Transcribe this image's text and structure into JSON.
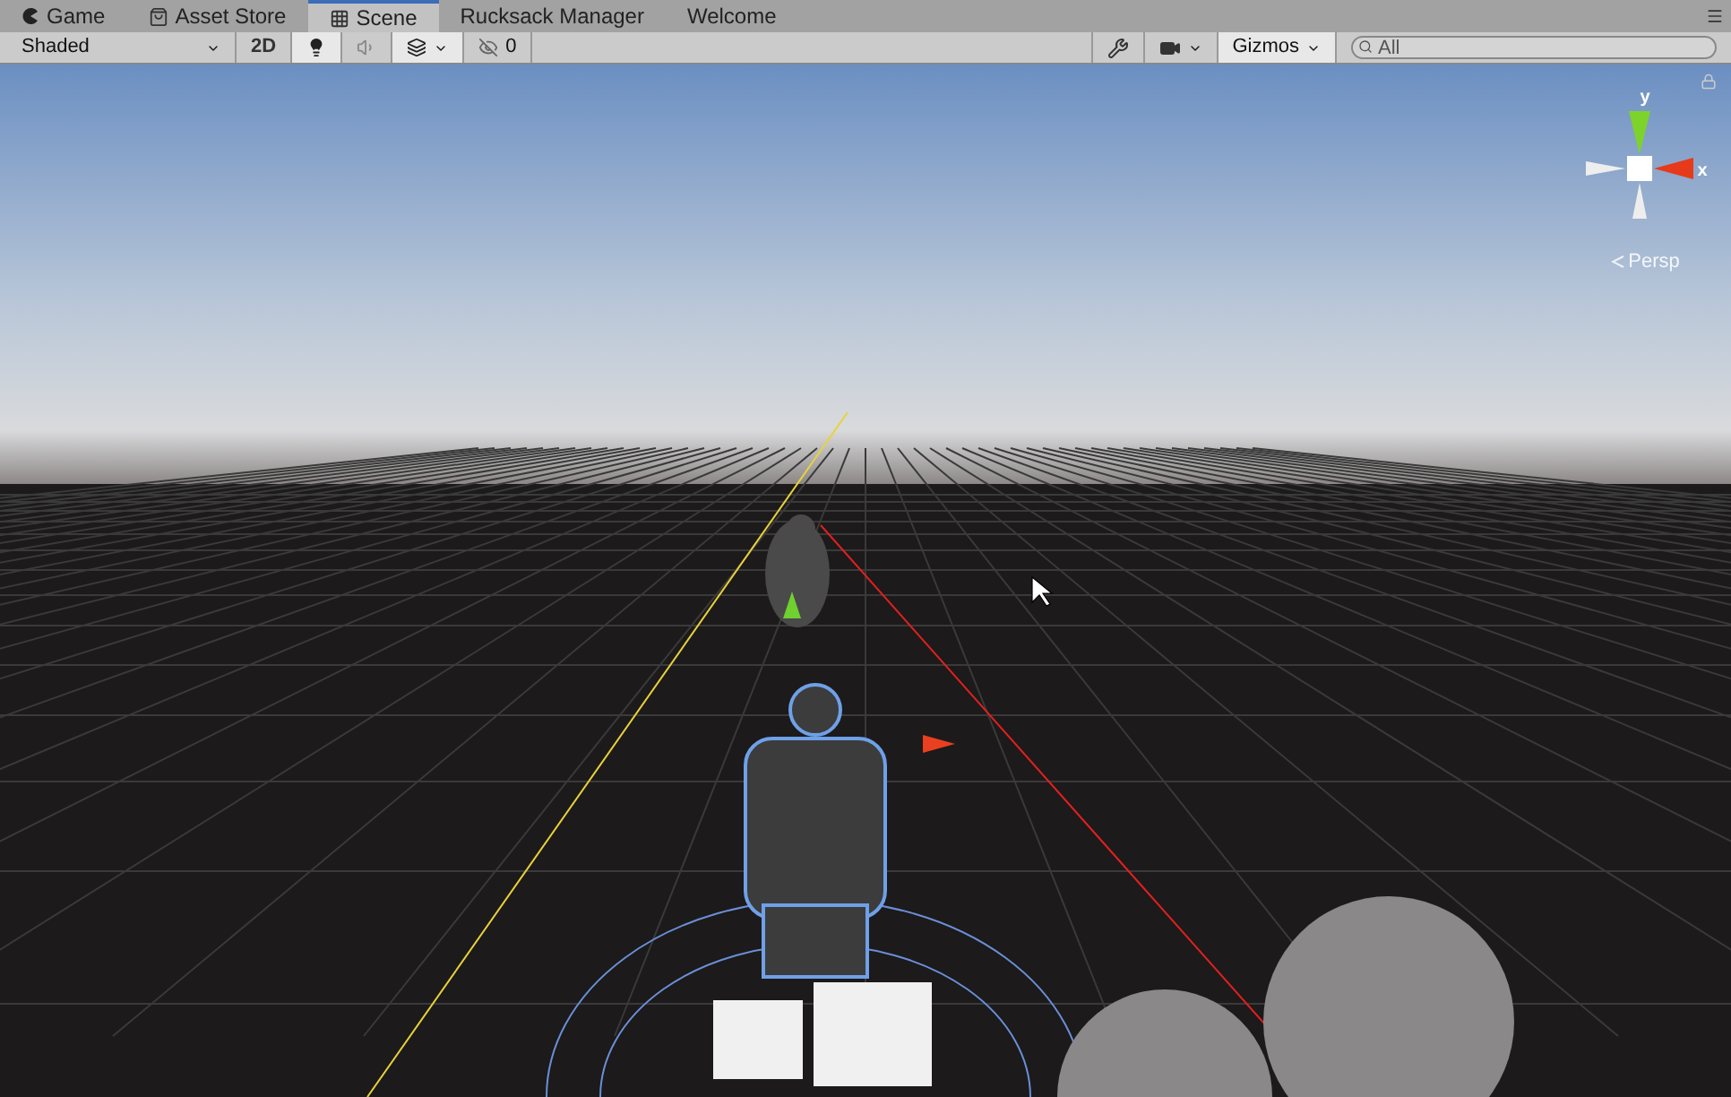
{
  "tabs": [
    {
      "label": "Game",
      "selected": false
    },
    {
      "label": "Asset Store",
      "selected": false
    },
    {
      "label": "Scene",
      "selected": true
    },
    {
      "label": "Rucksack Manager",
      "selected": false
    },
    {
      "label": "Welcome",
      "selected": false
    }
  ],
  "toolbar": {
    "shading": {
      "value": "Shaded"
    },
    "mode_2d": {
      "label": "2D",
      "on": false
    },
    "lighting": {
      "on": true
    },
    "audio": {
      "on": false
    },
    "effects": {
      "on": true
    },
    "hidden_count": "0",
    "gizmos": {
      "label": "Gizmos",
      "on": true
    },
    "search": {
      "placeholder": "All"
    }
  },
  "scene": {
    "gizmo": {
      "y_label": "y",
      "x_label": "x",
      "projection": "Persp"
    }
  }
}
